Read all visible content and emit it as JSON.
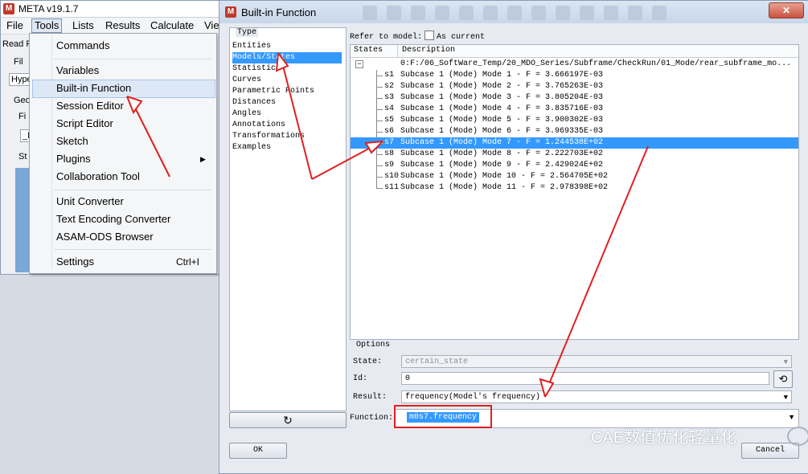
{
  "main_window": {
    "title": "META v19.1.7",
    "menu": [
      "File",
      "Tools",
      "Lists",
      "Results",
      "Calculate",
      "Vie"
    ],
    "side_fragments": [
      "Read F",
      "Fil",
      "Hype",
      "Geo",
      "Fi",
      "_M",
      "St"
    ]
  },
  "tools_menu": {
    "items": [
      {
        "label": "Commands"
      },
      {
        "label": "Variables"
      },
      {
        "label": "Built-in Function",
        "highlighted": true
      },
      {
        "label": "Session Editor"
      },
      {
        "label": "Script Editor"
      },
      {
        "label": "Sketch"
      },
      {
        "label": "Plugins",
        "submenu": true
      },
      {
        "label": "Collaboration Tool"
      },
      {
        "label": "Unit Converter"
      },
      {
        "label": "Text Encoding Converter"
      },
      {
        "label": "ASAM-ODS Browser"
      },
      {
        "label": "Settings",
        "shortcut": "Ctrl+I"
      }
    ],
    "submenu_arrow": "▶"
  },
  "dialog": {
    "title": "Built-in Function",
    "type_label": "Type",
    "types": [
      "Entities",
      "Models/States",
      "Statistics",
      "Curves",
      "Parametric Points",
      "Distances",
      "Angles",
      "Annotations",
      "Transformations",
      "Examples"
    ],
    "selected_type": "Models/States",
    "refer_to_model_label": "Refer to model:",
    "as_current_label": "As current",
    "states_header": "States",
    "description_header": "Description",
    "root_path": "0:F:/06_SoftWare_Temp/20_MDO_Series/Subframe/CheckRun/01_Mode/rear_subframe_mo...",
    "states": [
      {
        "id": "s1",
        "desc": "Subcase 1 (Mode) Mode 1 - F = 3.666197E-03"
      },
      {
        "id": "s2",
        "desc": "Subcase 1 (Mode) Mode 2 - F = 3.765263E-03"
      },
      {
        "id": "s3",
        "desc": "Subcase 1 (Mode) Mode 3 - F = 3.805204E-03"
      },
      {
        "id": "s4",
        "desc": "Subcase 1 (Mode) Mode 4 - F = 3.835716E-03"
      },
      {
        "id": "s5",
        "desc": "Subcase 1 (Mode) Mode 5 - F = 3.900302E-03"
      },
      {
        "id": "s6",
        "desc": "Subcase 1 (Mode) Mode 6 - F = 3.969335E-03"
      },
      {
        "id": "s7",
        "desc": "Subcase 1 (Mode) Mode 7 - F = 1.244538E+02",
        "selected": true
      },
      {
        "id": "s8",
        "desc": "Subcase 1 (Mode) Mode 8 - F = 2.222703E+02"
      },
      {
        "id": "s9",
        "desc": "Subcase 1 (Mode) Mode 9 - F = 2.429024E+02"
      },
      {
        "id": "s10",
        "desc": "Subcase 1 (Mode) Mode 10 - F = 2.564705E+02"
      },
      {
        "id": "s11",
        "desc": "Subcase 1 (Mode) Mode 11 - F = 2.978398E+02"
      }
    ],
    "options_label": "Options",
    "state_label": "State:",
    "state_value": "certain_state",
    "id_label": "Id:",
    "id_value": "0",
    "result_label": "Result:",
    "result_value": "frequency(Model's frequency)",
    "function_label": "Function:",
    "function_value": "m0s7.frequency",
    "ok_label": "OK",
    "cancel_label": "Cancel",
    "refresh_icon": "↻"
  },
  "watermark": "CAE数值优化轻量化",
  "colors": {
    "selection": "#3399ff",
    "annotation": "#e02020"
  }
}
